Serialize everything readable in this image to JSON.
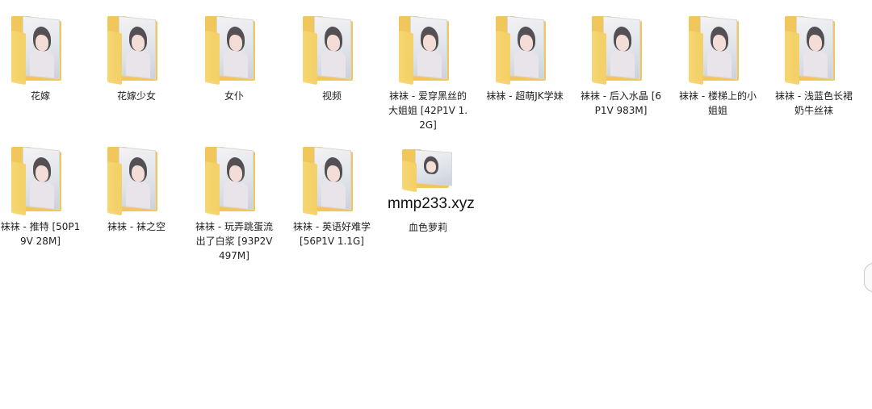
{
  "explorer": {
    "items": [
      {
        "label": "花嫁"
      },
      {
        "label": "花嫁少女"
      },
      {
        "label": "女仆"
      },
      {
        "label": "视频"
      },
      {
        "label": "袜袜 - 爱穿黑丝的大姐姐 [42P1V 1.2G]"
      },
      {
        "label": "袜袜 - 超萌JK学妹"
      },
      {
        "label": "袜袜 - 后入水晶 [6P1V 983M]"
      },
      {
        "label": "袜袜 - 楼梯上的小姐姐"
      },
      {
        "label": "袜袜 - 浅蓝色长裙奶牛丝袜"
      },
      {
        "label": "袜袜 - 推特 [50P19V 28M]"
      },
      {
        "label": "袜袜 - 袜之空"
      },
      {
        "label": "袜袜 - 玩弄跳蛋流出了白浆 [93P2V 497M]"
      },
      {
        "label": "袜袜 - 英语好难学 [56P1V 1.1G]"
      },
      {
        "label": "血色萝莉"
      }
    ],
    "watermark": "mmp233.xyz",
    "icon": "folder-icon",
    "colors": {
      "folder": "#f1c65b",
      "background": "#ffffff",
      "text": "#1f1f1f"
    }
  }
}
